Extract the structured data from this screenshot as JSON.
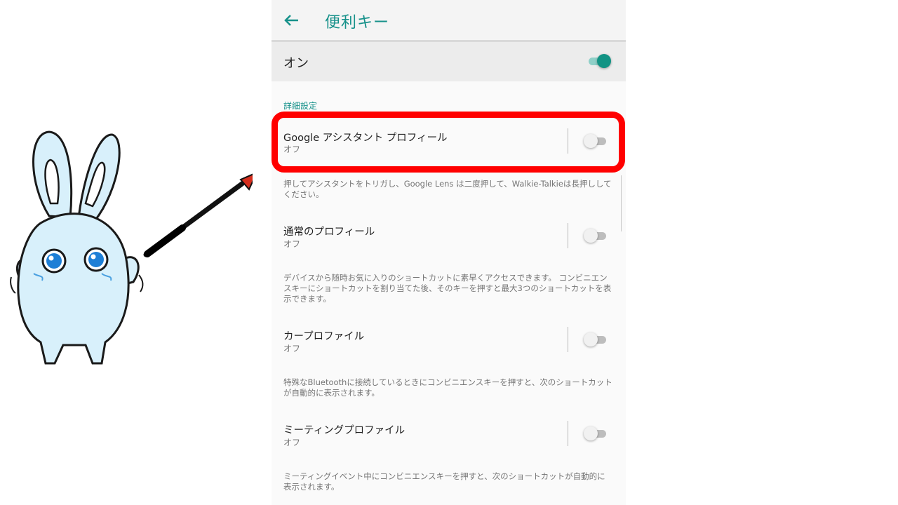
{
  "appbar": {
    "title": "便利キー",
    "back_icon": "arrow-left-icon"
  },
  "master_toggle": {
    "label": "オン",
    "on": true
  },
  "section": {
    "header": "詳細設定"
  },
  "preferences": [
    {
      "title": "Google アシスタント プロフィール",
      "summary": "オフ",
      "on": false,
      "description": "押してアシスタントをトリガし、Google Lens は二度押して、Walkie-Talkieは長押ししてください。",
      "highlighted": true
    },
    {
      "title": "通常のプロフィール",
      "summary": "オフ",
      "on": false,
      "description": "デバイスから随時お気に入りのショートカットに素早くアクセスできます。 コンビニエンスキーにショートカットを割り当てた後、そのキーを押すと最大3つのショートカットを表示できます。"
    },
    {
      "title": "カープロファイル",
      "summary": "オフ",
      "on": false,
      "description": "特殊なBluetoothに接続しているときにコンビニエンスキーを押すと、次のショートカットが自動的に表示されます。"
    },
    {
      "title": "ミーティングプロファイル",
      "summary": "オフ",
      "on": false,
      "description": "ミーティングイベント中にコンビニエンスキーを押すと、次のショートカットが自動的に表示されます。"
    }
  ],
  "colors": {
    "accent": "#16918a",
    "highlight": "#ff0000",
    "mascot_body": "#d8f0fb",
    "mascot_eye": "#1e7fd6"
  }
}
